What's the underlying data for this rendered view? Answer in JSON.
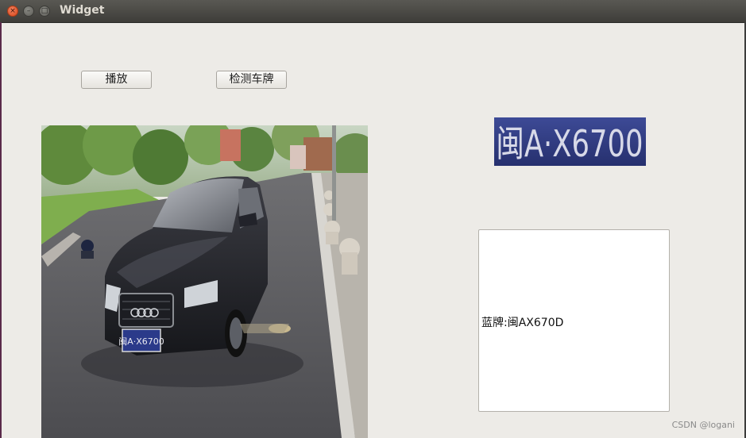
{
  "window": {
    "title": "Widget",
    "close_glyph": "×",
    "minimize_glyph": "–",
    "maximize_glyph": "□"
  },
  "toolbar": {
    "play_label": "播放",
    "detect_label": "检测车牌"
  },
  "plate": {
    "crop_text": "闽A·X6700",
    "car_plate_text": "闽A·X6700",
    "plate_color": "#2b3a8a"
  },
  "result": {
    "text": "蓝牌:闽AX670D"
  },
  "watermark": "CSDN @logani"
}
